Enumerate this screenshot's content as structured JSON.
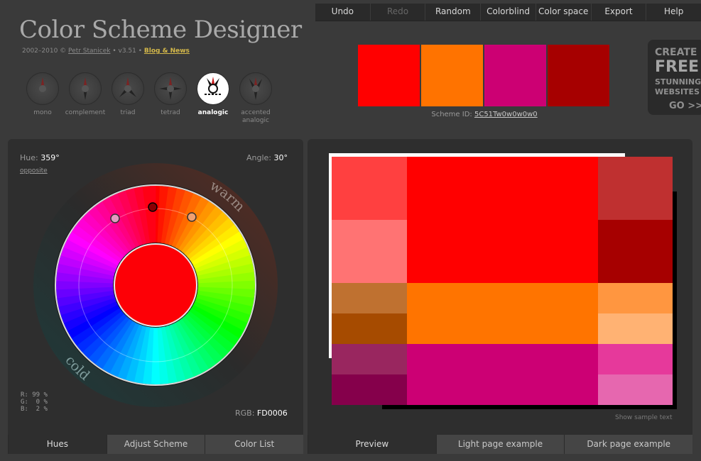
{
  "app": {
    "title": "Color Scheme Designer",
    "credit_prefix": "2002–2010 ©",
    "author": "Petr Stanicek",
    "version": "• v3.51 •",
    "blog": "Blog & News"
  },
  "menu": [
    {
      "label": "Undo",
      "enabled": true
    },
    {
      "label": "Redo",
      "enabled": false
    },
    {
      "label": "Random",
      "enabled": true
    },
    {
      "label": "Colorblind",
      "enabled": true
    },
    {
      "label": "Color space",
      "enabled": true
    },
    {
      "label": "Export",
      "enabled": true
    },
    {
      "label": "Help",
      "enabled": true
    }
  ],
  "swatches": [
    "#ff0000",
    "#ff7300",
    "#cc0073",
    "#a60000"
  ],
  "scheme": {
    "label": "Scheme ID:",
    "id": "5C51Tw0w0w0w0"
  },
  "ad": {
    "line1": "CREATE",
    "line2": "FREE",
    "line3": "STUNNING",
    "line4": "WEBSITES",
    "line5": "GO >>"
  },
  "modes": [
    {
      "label": "mono",
      "active": false
    },
    {
      "label": "complement",
      "active": false
    },
    {
      "label": "triad",
      "active": false
    },
    {
      "label": "tetrad",
      "active": false
    },
    {
      "label": "analogic",
      "active": true
    },
    {
      "label": "accented analogic",
      "active": false
    }
  ],
  "wheel": {
    "hue_label": "Hue:",
    "hue_value": "359°",
    "angle_label": "Angle:",
    "angle_value": "30°",
    "opposite": "opposite",
    "warm_label": "warm",
    "cold_label": "cold",
    "center_color": "#fd0006",
    "r": "R: 99 %",
    "g": "G:  0 %",
    "b": "B:  2 %",
    "rgb_label": "RGB:",
    "rgb_value": "FD0006"
  },
  "tabs_left": [
    {
      "label": "Hues",
      "active": true
    },
    {
      "label": "Adjust Scheme",
      "active": false
    },
    {
      "label": "Color List",
      "active": false
    }
  ],
  "preview": {
    "sample_text": "Show sample text",
    "colors": {
      "red_main": "#ff0000",
      "red_l1": "#ff4040",
      "red_l2": "#ff7373",
      "red_d1": "#bf3030",
      "red_d2": "#a60000",
      "orange_main": "#ff7400",
      "orange_l1": "#ff9640",
      "orange_l2": "#ffb273",
      "orange_d1": "#bf7130",
      "orange_d2": "#a64b00",
      "pink_main": "#cc0074",
      "pink_l1": "#e6399b",
      "pink_l2": "#e667af",
      "pink_d1": "#99265f",
      "pink_d2": "#85004b"
    }
  },
  "tabs_right": [
    {
      "label": "Preview",
      "active": true
    },
    {
      "label": "Light page example",
      "active": false
    },
    {
      "label": "Dark page example",
      "active": false
    }
  ]
}
